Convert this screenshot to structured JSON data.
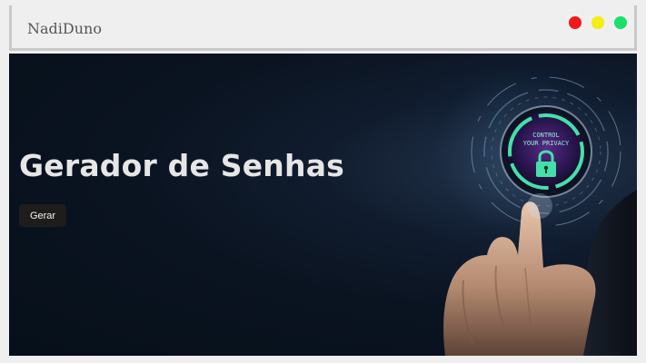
{
  "window": {
    "title": "NadiDuno",
    "controls": [
      {
        "name": "close",
        "color": "#ef1b1b"
      },
      {
        "name": "minimize",
        "color": "#f3ef10"
      },
      {
        "name": "maximize",
        "color": "#18e06b"
      }
    ]
  },
  "hero": {
    "title": "Gerador de Senhas",
    "button_label": "Gerar",
    "image": {
      "caption_line1": "CONTROL",
      "caption_line2": "YOUR PRIVACY",
      "icon": "padlock-icon",
      "accent_color": "#45e0a8"
    }
  }
}
